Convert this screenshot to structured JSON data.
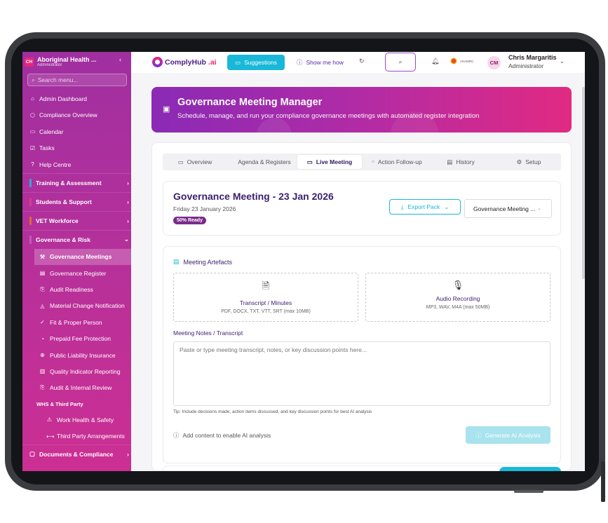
{
  "sidebar": {
    "org_initials": "CH",
    "org_name": "Aboriginal Health ...",
    "org_role": "Administrator",
    "search_placeholder": "Search menu...",
    "top_items": [
      {
        "label": "Admin Dashboard",
        "icon": "home-icon"
      },
      {
        "label": "Compliance Overview",
        "icon": "shield-icon"
      },
      {
        "label": "Calendar",
        "icon": "calendar-icon"
      },
      {
        "label": "Tasks",
        "icon": "checkbox-icon"
      },
      {
        "label": "Help Centre",
        "icon": "help-icon"
      }
    ],
    "sections": [
      {
        "label": "Training & Assessment",
        "color": "#2fa8d8"
      },
      {
        "label": "Students & Support",
        "color": "#d83a8a"
      },
      {
        "label": "VET Workforce",
        "color": "#e06a2a"
      },
      {
        "label": "Governance & Risk",
        "color": "#c05ac0"
      }
    ],
    "governance_items": [
      {
        "label": "Governance Meetings",
        "icon": "gavel-icon",
        "active": true
      },
      {
        "label": "Governance Register",
        "icon": "clipboard-icon"
      },
      {
        "label": "Audit Readiness",
        "icon": "audit-icon"
      },
      {
        "label": "Material Change Notification",
        "icon": "alert-icon"
      },
      {
        "label": "Fit & Proper Person",
        "icon": "check-shield-icon"
      },
      {
        "label": "Prepaid Fee Protection",
        "icon": "piggy-icon"
      },
      {
        "label": "Public Liability Insurance",
        "icon": "insurance-icon"
      },
      {
        "label": "Quality Indicator Reporting",
        "icon": "chart-icon"
      },
      {
        "label": "Audit & Internal Review",
        "icon": "review-icon"
      }
    ],
    "whs_group": "WHS & Third Party",
    "whs_items": [
      {
        "label": "Work Health & Safety",
        "icon": "warning-icon"
      },
      {
        "label": "Third Party Arrangements",
        "icon": "link-icon"
      }
    ],
    "docs_section": "Documents & Compliance"
  },
  "topbar": {
    "logo_text": "ComplyHub",
    "logo_suffix": ".ai",
    "suggestions_label": "Suggestions",
    "show_me_label": "Show me how",
    "org_logo_text": "AHAMRC",
    "user_initials": "CM",
    "user_name": "Chris Margaritis",
    "user_role": "Administrator"
  },
  "hero": {
    "title": "Governance Meeting Manager",
    "subtitle": "Schedule, manage, and run your compliance governance meetings with automated register integration"
  },
  "tabs": [
    {
      "label": "Overview",
      "icon": "calendar-icon"
    },
    {
      "label": "Agenda & Registers",
      "icon": ""
    },
    {
      "label": "Live Meeting",
      "icon": "calendar-icon",
      "active": true
    },
    {
      "label": "Action Follow-up",
      "icon": "dot-icon"
    },
    {
      "label": "History",
      "icon": "document-icon"
    },
    {
      "label": "Setup",
      "icon": "gear-icon"
    }
  ],
  "meeting": {
    "title": "Governance Meeting - 23 Jan 2026",
    "date": "Friday 23 January 2026",
    "status_badge": "50% Ready",
    "export_label": "Export Pack",
    "select_value": "Governance Meeting ..."
  },
  "artefacts": {
    "title": "Meeting Artefacts",
    "transcript_title": "Transcript / Minutes",
    "transcript_formats": "PDF, DOCX, TXT, VTT, SRT (max 10MB)",
    "audio_title": "Audio Recording",
    "audio_formats": "MP3, WAV, M4A (max 50MB)",
    "notes_label": "Meeting Notes / Transcript",
    "notes_placeholder": "Paste or type meeting transcript, notes, or key discussion points here...",
    "tip": "Tip: Include decisions made, action items discussed, and key discussion points for best AI analysis",
    "ai_hint": "Add content to enable AI analysis",
    "ai_button": "Generate AI Analysis"
  },
  "colors": {
    "accent_cyan": "#19b8d8",
    "brand_purple": "#3b1f6e",
    "brand_pink": "#e8267b"
  }
}
